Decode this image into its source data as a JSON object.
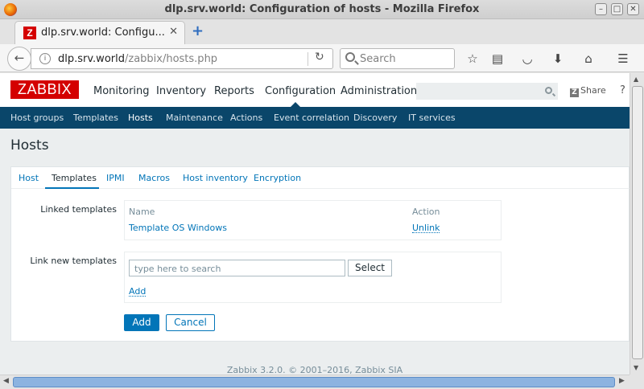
{
  "window": {
    "title": "dlp.srv.world: Configuration of hosts - Mozilla Firefox"
  },
  "browser": {
    "tab_title": "dlp.srv.world: Configu...",
    "url_host": "dlp.srv.world",
    "url_path": "/zabbix/hosts.php",
    "search_placeholder": "Search"
  },
  "header": {
    "logo": "ZABBIX",
    "menu": [
      "Monitoring",
      "Inventory",
      "Reports",
      "Configuration",
      "Administration"
    ],
    "active_menu": "Configuration",
    "share_label": "Share",
    "help_label": "?"
  },
  "submenu": [
    "Host groups",
    "Templates",
    "Hosts",
    "Maintenance",
    "Actions",
    "Event correlation",
    "Discovery",
    "IT services"
  ],
  "page": {
    "title": "Hosts",
    "tabs": [
      "Host",
      "Templates",
      "IPMI",
      "Macros",
      "Host inventory",
      "Encryption"
    ],
    "active_tab": "Templates",
    "linked_templates_label": "Linked templates",
    "col_name": "Name",
    "col_action": "Action",
    "linked_rows": [
      {
        "name": "Template OS Windows",
        "action": "Unlink"
      }
    ],
    "link_new_label": "Link new templates",
    "search_placeholder": "type here to search",
    "select_label": "Select",
    "add_link_label": "Add",
    "add_button": "Add",
    "cancel_button": "Cancel"
  },
  "footer": "Zabbix 3.2.0. © 2001–2016, Zabbix SIA"
}
